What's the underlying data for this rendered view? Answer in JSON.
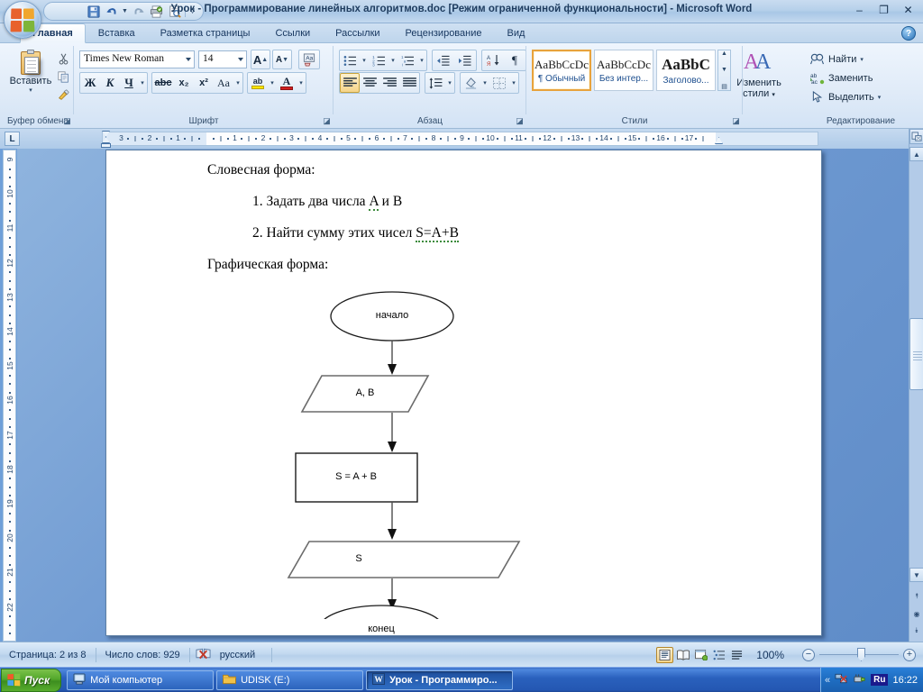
{
  "window": {
    "title": "Урок - Программирование линейных алгоритмов.doc [Режим ограниченной функциональности] - Microsoft Word",
    "minimize": "–",
    "restore": "❐",
    "close": "✕",
    "help_label": "?"
  },
  "office_orb": {
    "name": "office-button"
  },
  "quick_access": {
    "items": [
      {
        "name": "save-icon",
        "glyph": "💾",
        "label": "Сохранить"
      },
      {
        "name": "undo-icon",
        "glyph": "↺",
        "label": "Отменить"
      },
      {
        "name": "undo-dropdown-icon",
        "glyph": "▾",
        "label": "Отменить список"
      },
      {
        "name": "redo-icon",
        "glyph": "↻",
        "label": "Вернуть"
      },
      {
        "name": "print-icon",
        "glyph": "🖶",
        "label": "Быстрая печать"
      },
      {
        "name": "print-preview-icon",
        "glyph": "🔍",
        "label": "Предварительный просмотр"
      },
      {
        "name": "customize-qat-icon",
        "glyph": "▾",
        "label": "Настройка панели быстрого доступа"
      }
    ]
  },
  "tabs": [
    {
      "label": "Главная",
      "active": true
    },
    {
      "label": "Вставка",
      "active": false
    },
    {
      "label": "Разметка страницы",
      "active": false
    },
    {
      "label": "Ссылки",
      "active": false
    },
    {
      "label": "Рассылки",
      "active": false
    },
    {
      "label": "Рецензирование",
      "active": false
    },
    {
      "label": "Вид",
      "active": false
    }
  ],
  "ribbon": {
    "clipboard": {
      "group_label": "Буфер обмена",
      "paste_label": "Вставить",
      "paste_caret": "▾",
      "cut_glyph": "✂",
      "copy_glyph": "⧉",
      "format_painter_glyph": "🖌",
      "dialog_launcher": "◪"
    },
    "font": {
      "group_label": "Шрифт",
      "font_name": "Times New Roman",
      "font_size": "14",
      "grow_font": "A",
      "shrink_font": "A",
      "clear_format": "Aa",
      "bold": "Ж",
      "italic": "К",
      "underline": "Ч",
      "underline_caret": "▾",
      "strike": "abc",
      "subscript": "x₂",
      "superscript": "x²",
      "change_case": "Aa",
      "change_case_caret": "▾",
      "highlight": "ab",
      "highlight_caret": "▾",
      "font_color": "A",
      "font_color_caret": "▾",
      "dialog_launcher": "◪"
    },
    "paragraph": {
      "group_label": "Абзац",
      "bullets": "≔",
      "bullets_caret": "▾",
      "numbering": "≕",
      "numbering_caret": "▾",
      "multilevel": "≖",
      "multilevel_caret": "▾",
      "decrease_indent": "⇤",
      "increase_indent": "⇥",
      "sort": "А↓",
      "show_marks": "¶",
      "align_left": "≡",
      "align_center": "≡",
      "align_right": "≡",
      "justify": "≡",
      "line_spacing": "↕≡",
      "line_spacing_caret": "▾",
      "shading": "▧",
      "shading_caret": "▾",
      "borders": "⊞",
      "borders_caret": "▾",
      "dialog_launcher": "◪"
    },
    "styles": {
      "group_label": "Стили",
      "gallery": [
        {
          "sample": "AaBbCcDc",
          "name": "¶ Обычный",
          "selected": true,
          "big": false
        },
        {
          "sample": "AaBbCcDc",
          "name": "Без интер...",
          "selected": false,
          "big": false
        },
        {
          "sample": "AaBbC",
          "name": "Заголово...",
          "selected": false,
          "big": true
        }
      ],
      "scroll_up": "▲",
      "scroll_down": "▼",
      "more": "▤",
      "change_styles_label_1": "Изменить",
      "change_styles_label_2": "стили",
      "change_styles_caret": "▾",
      "change_styles_icon": "AA",
      "dialog_launcher": "◪"
    },
    "editing": {
      "group_label": "Редактирование",
      "items": [
        {
          "label": "Найти",
          "icon": "find-icon",
          "glyph": "🔍",
          "caret": "▾"
        },
        {
          "label": "Заменить",
          "icon": "replace-icon",
          "glyph": "ab",
          "caret": ""
        },
        {
          "label": "Выделить",
          "icon": "select-icon",
          "glyph": "↖",
          "caret": "▾"
        }
      ]
    }
  },
  "ruler": {
    "tab_stop_selector": "L",
    "horizontal_labels": [
      "3",
      "2",
      "1",
      "1",
      "2",
      "3",
      "4",
      "5",
      "6",
      "7",
      "8",
      "9",
      "10",
      "11",
      "12",
      "13",
      "14",
      "15",
      "16",
      "17"
    ],
    "vertical_labels": [
      "9",
      "10",
      "11",
      "12",
      "13",
      "14",
      "15",
      "16",
      "17",
      "18",
      "19",
      "20",
      "21",
      "22"
    ]
  },
  "document": {
    "heading1": "Словесная форма:",
    "item1": "1. Задать два числа A и B",
    "item2": "2. Найти сумму этих чисел S=A+B",
    "heading2": "Графическая форма:",
    "flowchart": {
      "type": "flowchart",
      "nodes": [
        {
          "id": "start",
          "shape": "ellipse",
          "label": "начало"
        },
        {
          "id": "input",
          "shape": "parallelogram",
          "label": "A, B"
        },
        {
          "id": "process",
          "shape": "rectangle",
          "label": "S = A + B"
        },
        {
          "id": "output",
          "shape": "parallelogram",
          "label": "S"
        },
        {
          "id": "end",
          "shape": "ellipse",
          "label": "конец"
        }
      ],
      "edges": [
        {
          "from": "start",
          "to": "input"
        },
        {
          "from": "input",
          "to": "process"
        },
        {
          "from": "process",
          "to": "output"
        },
        {
          "from": "output",
          "to": "end"
        }
      ]
    }
  },
  "scrollbar": {
    "select_object_icon": "⬓",
    "up_arrow": "▲",
    "down_arrow": "▼",
    "prev_page": "⯭",
    "select_browse_object": "◉",
    "next_page": "⯯"
  },
  "status_bar": {
    "page": "Страница: 2 из 8",
    "words": "Число слов: 929",
    "proofing_icon": "spelling-check-icon",
    "language": "русский",
    "views": [
      {
        "name": "print-layout-view",
        "glyph": "▤",
        "selected": true
      },
      {
        "name": "full-screen-reading-view",
        "glyph": "📖",
        "selected": false
      },
      {
        "name": "web-layout-view",
        "glyph": "🗔",
        "selected": false
      },
      {
        "name": "outline-view",
        "glyph": "⋮≡",
        "selected": false
      },
      {
        "name": "draft-view",
        "glyph": "≣",
        "selected": false
      }
    ],
    "zoom_level": "100%",
    "zoom_out": "−",
    "zoom_in": "+"
  },
  "taskbar": {
    "start_label": "Пуск",
    "buttons": [
      {
        "label": "Мой компьютер",
        "icon": "my-computer-icon",
        "active": false
      },
      {
        "label": "UDISK (E:)",
        "icon": "folder-icon",
        "active": false
      },
      {
        "label": "Урок - Программиро...",
        "icon": "word-doc-icon",
        "active": true
      }
    ],
    "tray": {
      "expand": "«",
      "icons": [
        {
          "name": "network-disconnected-icon",
          "glyph": "🖧"
        },
        {
          "name": "safely-remove-hardware-icon",
          "glyph": "🔌"
        }
      ],
      "language": "Ru",
      "time": "16:22"
    }
  },
  "colors": {
    "accent": "#2a61bd",
    "titlebar": "#b6d0ea",
    "ribbon": "#e0ebf8",
    "selected_style_border": "#e8a33d",
    "desktop": "#6f9ad2"
  }
}
